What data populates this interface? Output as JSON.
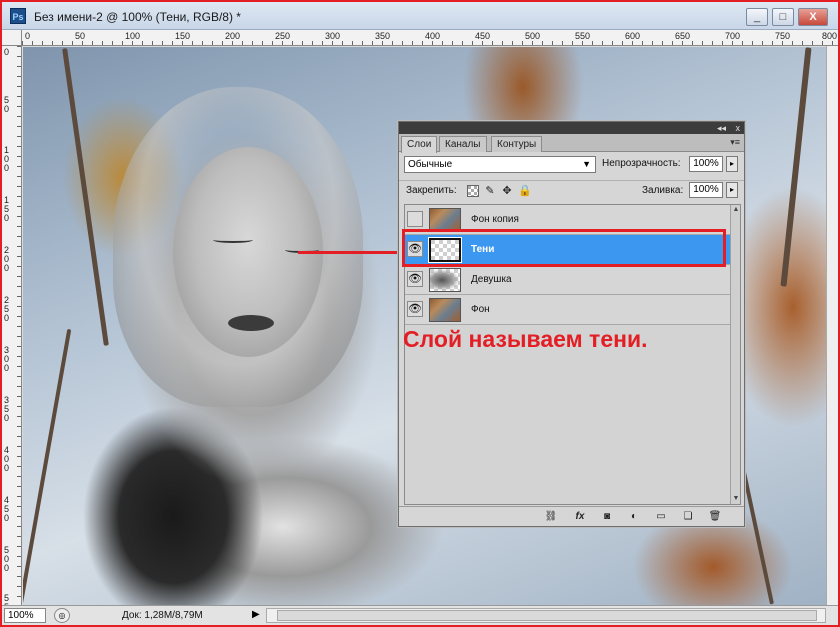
{
  "window": {
    "app_icon": "Ps",
    "title": "Без имени-2 @ 100% (Тени, RGB/8) *",
    "min": "_",
    "max": "□",
    "close": "X"
  },
  "ruler": {
    "top_labels": [
      "0",
      "50",
      "100",
      "150",
      "200",
      "250",
      "300",
      "350",
      "400",
      "450",
      "500",
      "550",
      "600",
      "650",
      "700",
      "750",
      "800"
    ],
    "left_labels": [
      "0",
      "50",
      "100",
      "150",
      "200",
      "250",
      "300",
      "350",
      "400",
      "450",
      "500",
      "550"
    ]
  },
  "layers_panel": {
    "collapse": "◂◂",
    "close": "x",
    "tabs": [
      "Слои",
      "Каналы",
      "Контуры"
    ],
    "menu": "▾≡",
    "blend_mode": "Обычные",
    "opacity_label": "Непрозрачность:",
    "opacity_value": "100%",
    "lock_label": "Закрепить:",
    "fill_label": "Заливка:",
    "fill_value": "100%",
    "layers": [
      {
        "name": "Фон копия",
        "visible": false,
        "selected": false,
        "thumb": "photo"
      },
      {
        "name": "Тени",
        "visible": true,
        "selected": true,
        "thumb": "trans"
      },
      {
        "name": "Девушка",
        "visible": true,
        "selected": false,
        "thumb": "girl"
      },
      {
        "name": "Фон",
        "visible": true,
        "selected": false,
        "thumb": "photo"
      }
    ],
    "footer_icons": [
      "link-icon",
      "fx-icon",
      "mask-icon",
      "adjustment-icon",
      "group-icon",
      "new-layer-icon",
      "trash-icon"
    ]
  },
  "annotation": {
    "caption": "Слой называем тени.",
    "color": "#e31e24"
  },
  "status": {
    "zoom": "100%",
    "doc": "Док: 1,28M/8,79M"
  }
}
